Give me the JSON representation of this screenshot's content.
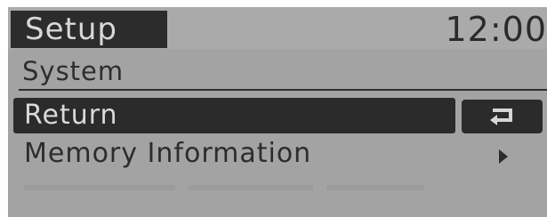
{
  "header": {
    "title": "Setup",
    "time": "12:00"
  },
  "section": {
    "title": "System"
  },
  "menu": {
    "items": [
      {
        "label": "Return",
        "selected": true
      },
      {
        "label": "Memory Information",
        "selected": false
      }
    ]
  },
  "icons": {
    "back": "return-arrow-icon",
    "submenu": "chevron-right-icon"
  },
  "colors": {
    "screen_bg": "#a3a3a3",
    "highlight_bg": "#2b2b2b",
    "highlight_text": "#dadada",
    "text": "#2c2c2c"
  }
}
